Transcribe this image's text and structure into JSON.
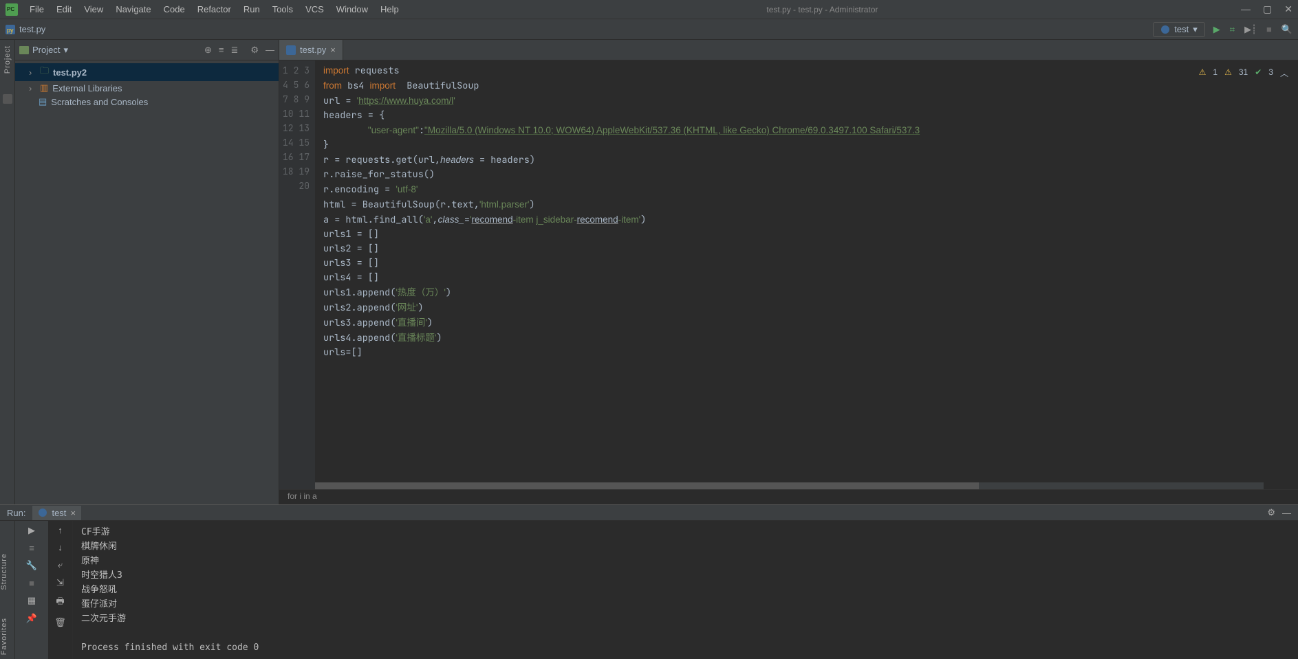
{
  "window": {
    "title": "test.py - test.py - Administrator"
  },
  "menu": [
    "File",
    "Edit",
    "View",
    "Navigate",
    "Code",
    "Refactor",
    "Run",
    "Tools",
    "VCS",
    "Window",
    "Help"
  ],
  "navbar": {
    "file": "test.py"
  },
  "run_config": {
    "name": "test"
  },
  "sidebar": {
    "title": "Project",
    "items": [
      {
        "label": "test.py2",
        "selected": true,
        "icon": "folder"
      },
      {
        "label": "External Libraries",
        "selected": false,
        "icon": "lib"
      },
      {
        "label": "Scratches and Consoles",
        "selected": false,
        "icon": "scratch"
      }
    ]
  },
  "tab": {
    "label": "test.py"
  },
  "inspection": {
    "warn": "1",
    "weak": "31",
    "ok": "3"
  },
  "code_lines": [
    {
      "n": 1,
      "html": "<span class='kw'>import</span> requests"
    },
    {
      "n": 2,
      "html": "<span class='kw'>from</span> bs4 <span class='kw'>import</span>  BeautifulSoup"
    },
    {
      "n": 3,
      "html": "url = <span class='str'>'</span><span class='link'>https://www.huya.com/l</span><span class='str'>'</span>"
    },
    {
      "n": 4,
      "html": "headers = {"
    },
    {
      "n": 5,
      "html": "        <span class='str'>\"user-agent\"</span>:<span class='link'>\"Mozilla/5.0 (Windows NT 10.0; WOW64) AppleWebKit/537.36 (KHTML, like Gecko) Chrome/69.0.3497.100 Safari/537.3</span>"
    },
    {
      "n": 6,
      "html": "}"
    },
    {
      "n": 7,
      "html": "r = requests.get(url,<span class='param'>headers</span> = headers)"
    },
    {
      "n": 8,
      "html": "r.raise_for_status()"
    },
    {
      "n": 9,
      "html": "r.encoding = <span class='str'>'utf-8'</span>"
    },
    {
      "n": 10,
      "html": "html = BeautifulSoup(r.text,<span class='str'>'html.parser'</span>)"
    },
    {
      "n": 11,
      "html": "a = html.find_all(<span class='str'>'a'</span>,<span class='param'>class_</span>=<span class='str'>'</span><span class='uline'>recomend</span><span class='str'>-item j_sidebar-</span><span class='uline'>recomend</span><span class='str'>-item'</span>)"
    },
    {
      "n": 12,
      "html": "urls1 = []"
    },
    {
      "n": 13,
      "html": "urls2 = []"
    },
    {
      "n": 14,
      "html": "urls3 = []"
    },
    {
      "n": 15,
      "html": "urls4 = []"
    },
    {
      "n": 16,
      "html": "urls1.append(<span class='str'>'热度（万）'</span>)"
    },
    {
      "n": 17,
      "html": "urls2.append(<span class='str'>'网址'</span>)"
    },
    {
      "n": 18,
      "html": "urls3.append(<span class='str'>'直播间'</span>)"
    },
    {
      "n": 19,
      "html": "urls4.append(<span class='str'>'直播标题'</span>)"
    },
    {
      "n": 20,
      "html": "urls=[]"
    }
  ],
  "breadcrumb": "for i in a",
  "run_panel": {
    "label": "Run:",
    "tab": "test",
    "output": [
      "CF手游",
      "棋牌休闲",
      "原神",
      "时空猎人3",
      "战争怒吼",
      "蛋仔派对",
      "二次元手游",
      "",
      "Process finished with exit code 0"
    ]
  },
  "left_labels": {
    "project": "Project",
    "structure": "Structure",
    "favorites": "Favorites"
  }
}
